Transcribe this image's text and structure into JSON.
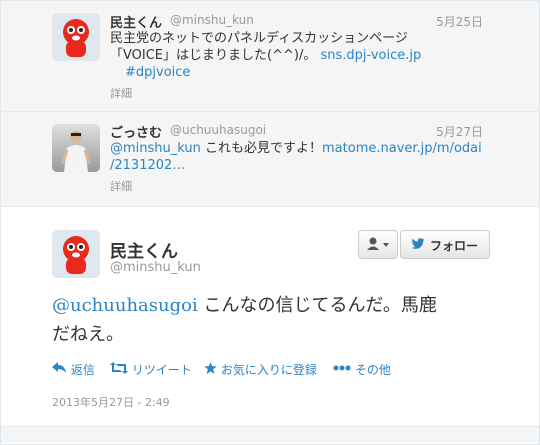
{
  "replies": [
    {
      "name": "民主くん",
      "handle": "@minshu_kun",
      "date": "5月25日",
      "text_line1": "民主党のネットでのパネルディスカッションページ",
      "text_line2_prefix": "「VOICE」はじまりました(^^)/。",
      "link1": "sns.dpj-voice.jp",
      "hashtag": "#dpjvoice",
      "details": "詳細"
    },
    {
      "name": "ごっさむ",
      "handle": "@uchuuhasugoi",
      "date": "5月27日",
      "mention": "@minshu_kun",
      "text_mid": " これも必見ですよ！",
      "link_line1": "matome.naver.jp/m/odai",
      "link_line2": "/2131202…",
      "details": "詳細"
    }
  ],
  "main_tweet": {
    "name": "民主くん",
    "handle": "@minshu_kun",
    "follow_label": "フォロー",
    "mention": "@uchuuhasugoi",
    "text_line1": " こんなの信じてるんだ。馬鹿",
    "text_line2": "だねえ。",
    "actions": {
      "reply": "返信",
      "retweet": "リツイート",
      "favorite": "お気に入りに登録",
      "more": "その他"
    },
    "timestamp": "2013年5月27日 - 2:49"
  },
  "colors": {
    "link": "#2a85c5",
    "muted": "#999999",
    "avatar_red": "#e8291c"
  }
}
